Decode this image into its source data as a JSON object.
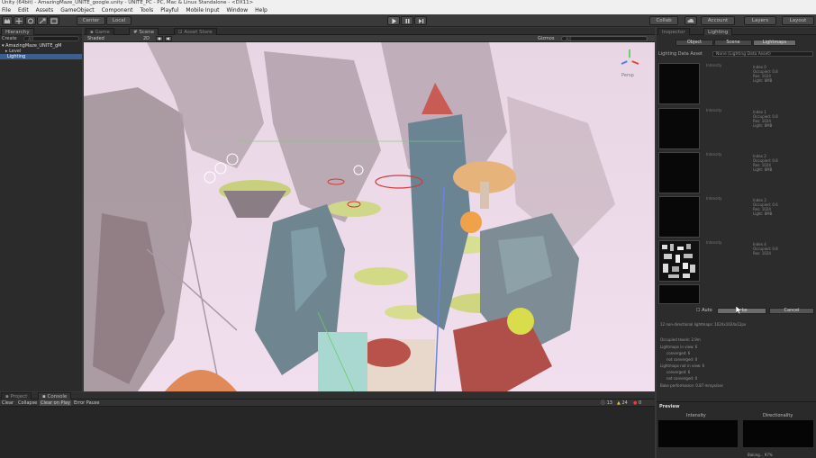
{
  "window": {
    "title": "Unity (64bit) - AmazingMaze_UNITE_google.unity - UNITE_PC - PC, Mac & Linux Standalone - <DX11>"
  },
  "menu": [
    "File",
    "Edit",
    "Assets",
    "GameObject",
    "Component",
    "Tools",
    "Playful",
    "Mobile Input",
    "Window",
    "Help"
  ],
  "toolbar": {
    "center_label": "Center",
    "local_label": "Local",
    "collab_label": "Collab",
    "account_label": "Account",
    "layers_label": "Layers",
    "layout_label": "Layout"
  },
  "hierarchy": {
    "tab": "Hierarchy",
    "create_label": "Create",
    "search_placeholder": "All",
    "scene": "AmazingMaze_UNITE_gM",
    "items": [
      "Level",
      "Lighting"
    ]
  },
  "scene_view": {
    "tabs": [
      "Game",
      "Scene",
      "Asset Store"
    ],
    "shading_mode": "Shaded",
    "mode_2d": "2D",
    "gizmos_label": "Gizmos",
    "search_placeholder": "All",
    "persp_label": "Persp"
  },
  "inspector": {
    "tabs": [
      "Inspector",
      "Lighting"
    ],
    "subtabs": [
      "Object",
      "Scene",
      "Lightmaps"
    ],
    "lighting_data_label": "Lighting Data Asset",
    "lighting_data_value": "None (Lighting Data Asset)",
    "lightmaps": [
      {
        "label": "Intensity",
        "info": "Index 0\nOccupied: 0.8\nRes: 1024\nLight: 8MB"
      },
      {
        "label": "Intensity",
        "info": "Index 1\nOccupied: 0.8\nRes: 1024\nLight: 8MB"
      },
      {
        "label": "Intensity",
        "info": "Index 2\nOccupied: 0.8\nRes: 1024\nLight: 8MB"
      },
      {
        "label": "Intensity",
        "info": "Index 3\nOccupied: 0.6\nRes: 1024\nLight: 8MB"
      },
      {
        "label": "Intensity",
        "info": "Index 4\nOccupied: 0.8\nRes: 1024"
      }
    ],
    "auto_label": "Auto",
    "bake_label": "Bake",
    "cancel_label": "Cancel",
    "stats": [
      "12 non-directional lightmaps: 1024x1024x12px",
      "Occupied texels: 2.9m",
      "Lightmaps in view: 6",
      "converged: 6",
      "not converged: 0",
      "Lightmaps not in view: 6",
      "converged: 6",
      "not converged: 0",
      "Bake performance: 0.87 mrays/sec"
    ],
    "preview_label": "Preview",
    "preview_cols": [
      "Intensity",
      "Directionality"
    ]
  },
  "bottom": {
    "tabs": [
      "Project",
      "Console"
    ],
    "buttons": [
      "Clear",
      "Collapse",
      "Clear on Play",
      "Error Pause"
    ],
    "counts": [
      "13",
      "24",
      "0"
    ]
  },
  "statusbar": {
    "text": "Baking... 97%"
  }
}
